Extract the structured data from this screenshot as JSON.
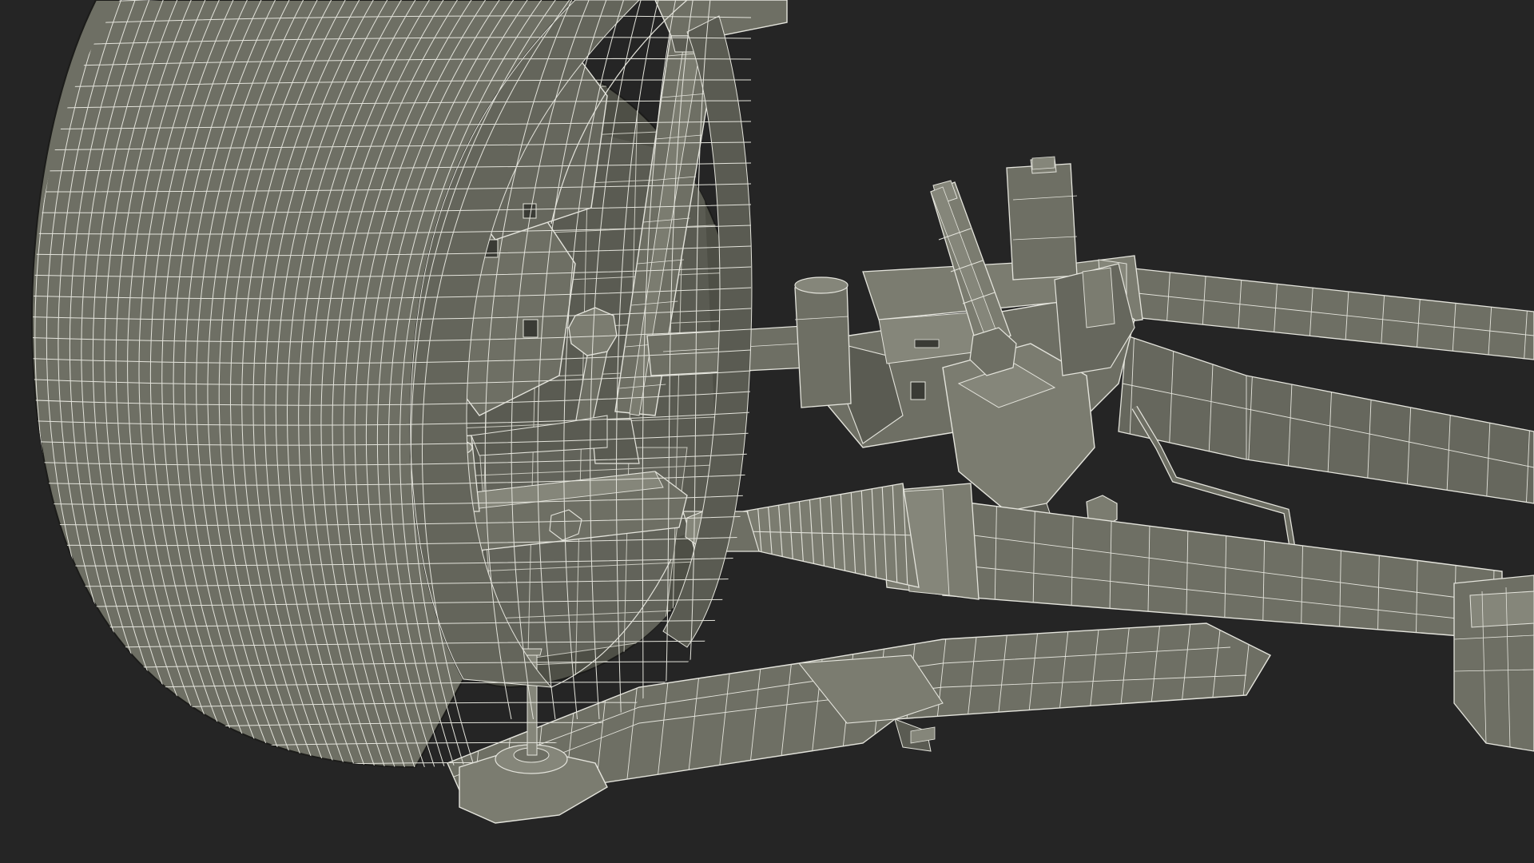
{
  "scene": {
    "colors": {
      "background": "#252525",
      "surface": "#6e6f64",
      "surface_light": "#85867a",
      "surface_dark": "#4e4f46",
      "shadow": "#3a3b35",
      "wire": "#e4e4dc",
      "wire_soft": "#c8c8be",
      "outline": "#1c1c1a"
    }
  }
}
